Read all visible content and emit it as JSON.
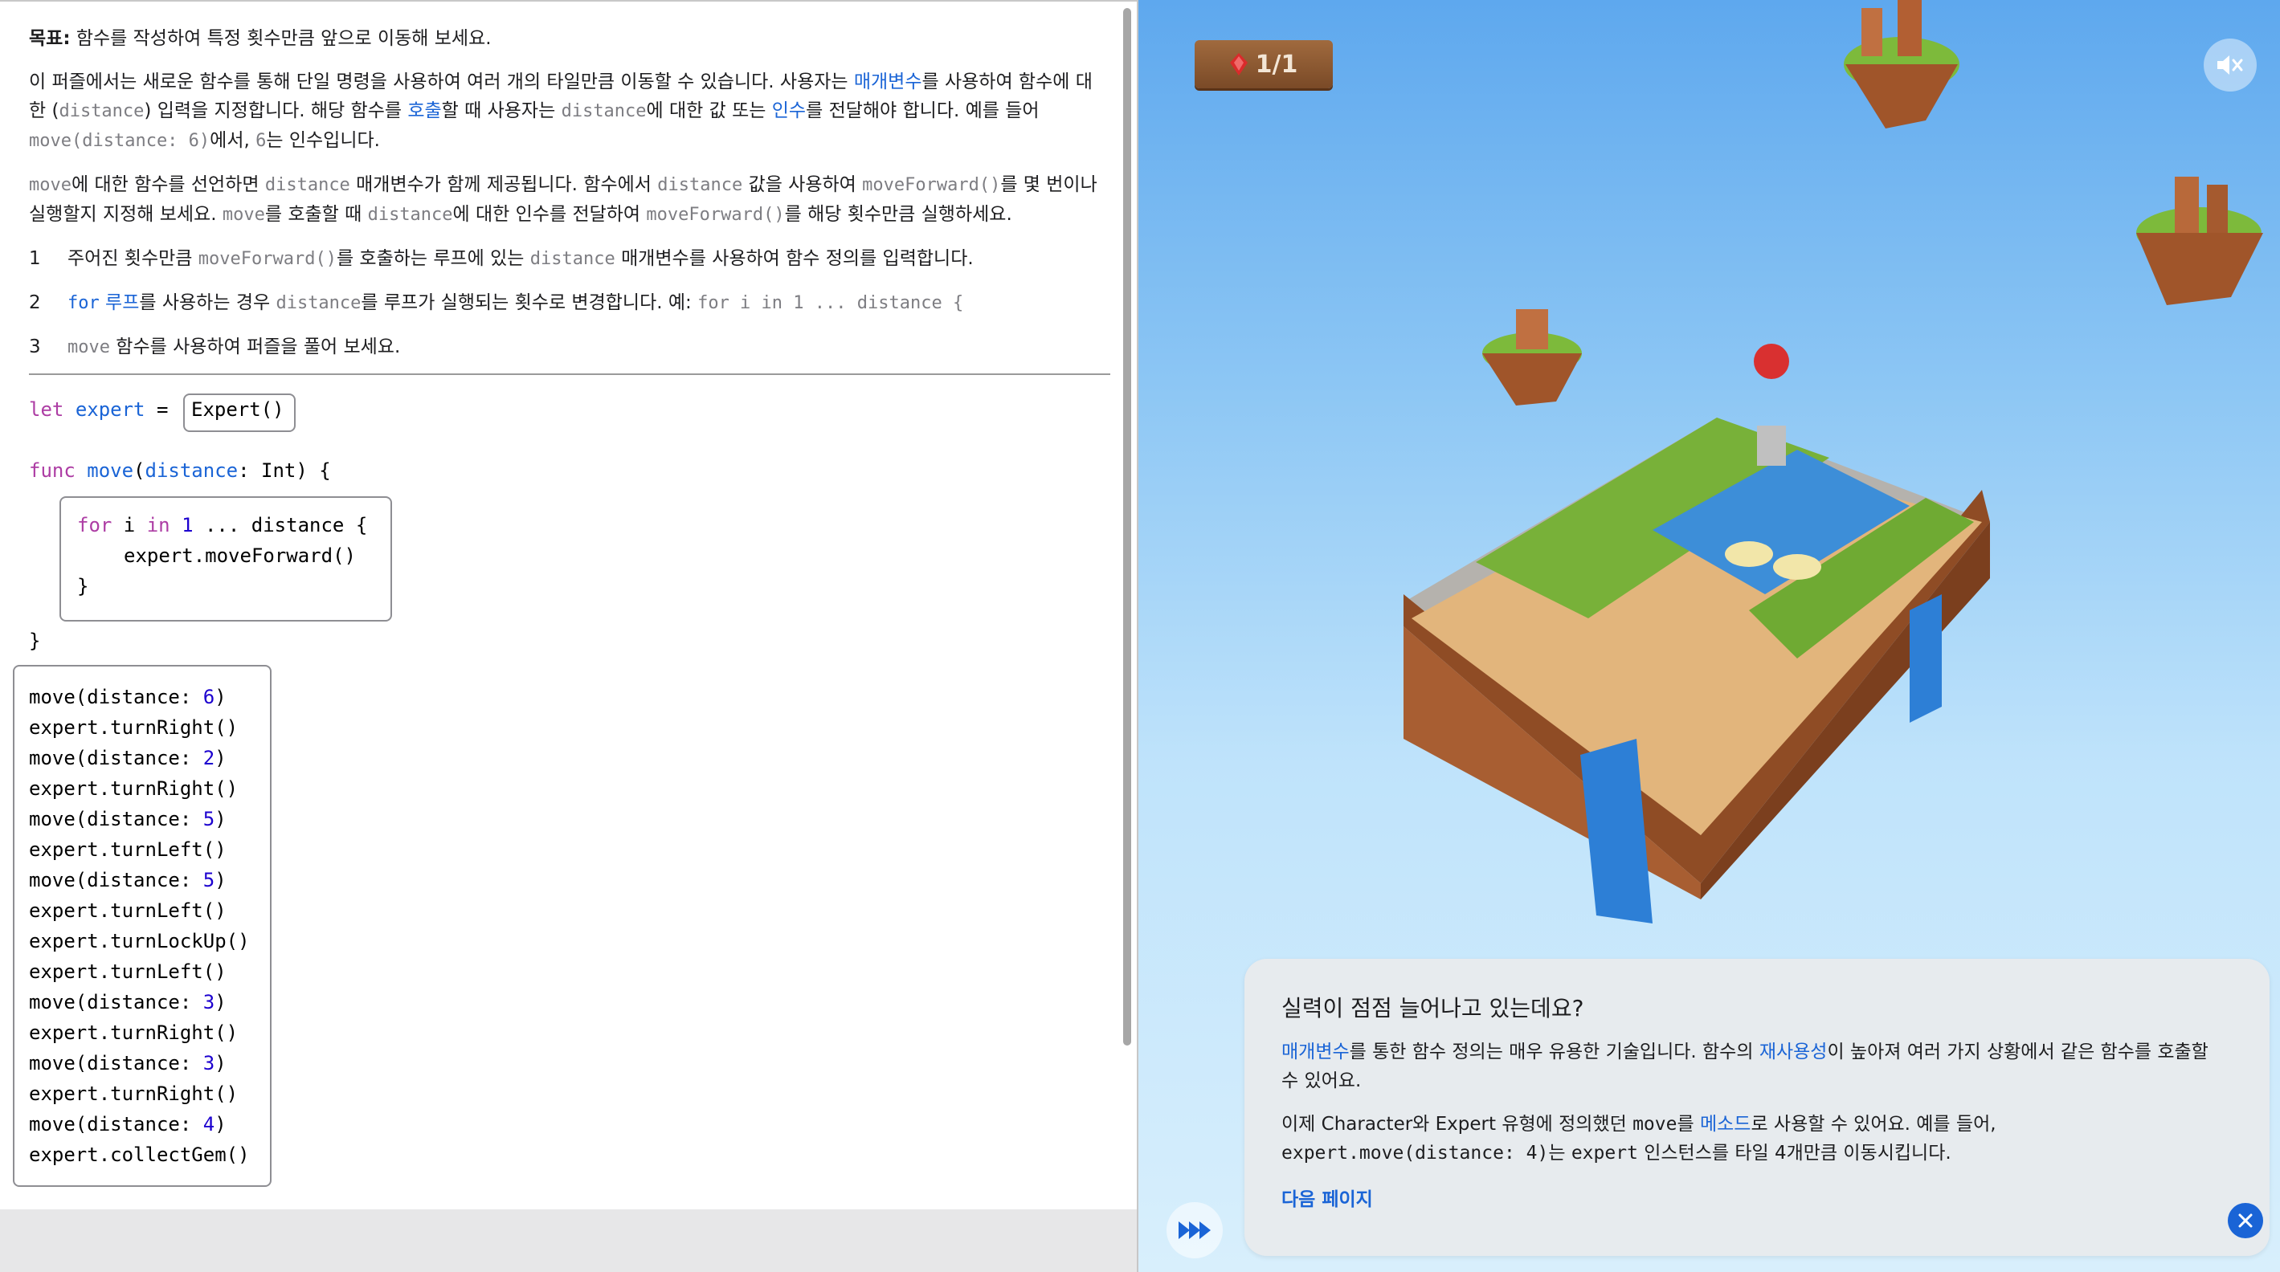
{
  "description": {
    "goal_label": "목표:",
    "goal_text": " 함수를 작성하여 특정 횟수만큼 앞으로 이동해 보세요.",
    "p1_a": "이 퍼즐에서는 새로운 함수를 통해 단일 명령을 사용하여 여러 개의 타일만큼 이동할 수 있습니다. 사용자는 ",
    "p1_link1": "매개변수",
    "p1_b": "를 사용하여 함수에 대한 (",
    "p1_code1": "distance",
    "p1_c": ") 입력을 지정합니다. 해당 함수를 ",
    "p1_link2": "호출",
    "p1_d": "할 때 사용자는 ",
    "p1_code2": "distance",
    "p1_e": "에 대한 값 또는 ",
    "p1_link3": "인수",
    "p1_f": "를 전달해야 합니다. 예를 들어 ",
    "p1_code3": "move(distance: 6)",
    "p1_g": "에서, ",
    "p1_code4": "6",
    "p1_h": "는 인수입니다.",
    "p2_code1": "move",
    "p2_a": "에 대한 함수를 선언하면 ",
    "p2_code2": "distance",
    "p2_b": " 매개변수가 함께 제공됩니다. 함수에서 ",
    "p2_code3": "distance",
    "p2_c": " 값을 사용하여 ",
    "p2_code4": "moveForward()",
    "p2_d": "를 몇 번이나 실행할지 지정해 보세요. ",
    "p2_code5": "move",
    "p2_e": "를 호출할 때 ",
    "p2_code6": "distance",
    "p2_f": "에 대한 인수를 전달하여 ",
    "p2_code7": "moveForward()",
    "p2_g": "를 해당 횟수만큼 실행하세요.",
    "step1_num": "1",
    "step1_a": "주어진 횟수만큼 ",
    "step1_code1": "moveForward()",
    "step1_b": "를 호출하는 루프에 있는 ",
    "step1_code2": "distance",
    "step1_c": " 매개변수를 사용하여 함수 정의를 입력합니다.",
    "step2_num": "2",
    "step2_code1": "for",
    "step2_link": " 루프",
    "step2_a": "를 사용하는 경우 ",
    "step2_code2": "distance",
    "step2_b": "를 루프가 실행되는 횟수로 변경합니다. 예: ",
    "step2_code3": "for i in 1 ... distance {",
    "step3_num": "3",
    "step3_code1": "move",
    "step3_a": " 함수를 사용하여 퍼즐을 풀어 보세요."
  },
  "code": {
    "let_kw": "let",
    "var_name": "expert",
    "eq": "=",
    "init": "Expert()",
    "func_kw": "func",
    "func_name": "move",
    "func_sig_a": "(",
    "param": "distance",
    "func_sig_b": ": Int) {",
    "for_kw": "for",
    "for_i": " i ",
    "in_kw": "in",
    "for_one": "1",
    "for_rest": " ... distance {",
    "body_line": "expert.moveForward()",
    "inner_close": "}",
    "outer_close": "}",
    "calls": [
      "move(distance: 6)",
      "expert.turnRight()",
      "move(distance: 2)",
      "expert.turnRight()",
      "move(distance: 5)",
      "expert.turnLeft()",
      "move(distance: 5)",
      "expert.turnLeft()",
      "expert.turnLockUp()",
      "expert.turnLeft()",
      "move(distance: 3)",
      "expert.turnRight()",
      "move(distance: 3)",
      "expert.turnRight()",
      "move(distance: 4)",
      "expert.collectGem()"
    ]
  },
  "game": {
    "gem_counter": "1/1",
    "mute_icon": "speaker-muted-icon",
    "fast_forward_icon": "fast-forward-icon"
  },
  "feedback": {
    "title": "실력이 점점 늘어나고 있는데요?",
    "p1_link1": "매개변수",
    "p1_a": "를 통한 함수 정의는 매우 유용한 기술입니다. 함수의 ",
    "p1_link2": "재사용성",
    "p1_b": "이 높아져 여러 가지 상황에서 같은 함수를 호출할 수 있어요.",
    "p2_a": "이제 Character와 Expert 유형에 정의했던 ",
    "p2_code1": "move",
    "p2_b": "를 ",
    "p2_link": "메소드",
    "p2_c": "로 사용할 수 있어요. 예를 들어, ",
    "p2_code2": "expert.move(distance: 4)",
    "p2_d": "는 ",
    "p2_code3": "expert",
    "p2_e": " 인스턴스를 타일 4개만큼 이동시킵니다.",
    "next_page": "다음 페이지"
  },
  "colors": {
    "link_blue": "#1a64d6",
    "keyword_purple": "#ad3da4",
    "number_blue": "#1c00cf"
  }
}
